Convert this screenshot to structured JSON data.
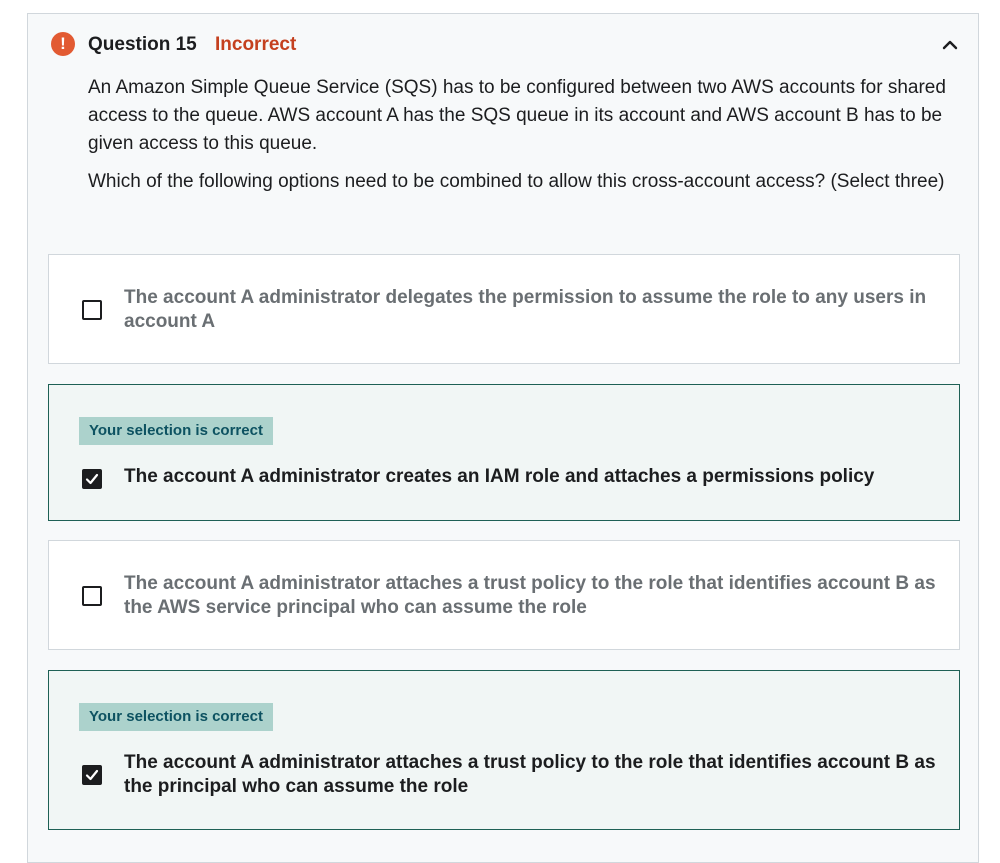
{
  "question": {
    "number_label": "Question 15",
    "status": "Incorrect",
    "prompt_paragraphs": [
      "An Amazon Simple Queue Service (SQS) has to be configured between two AWS accounts for shared access to the queue. AWS account A has the SQS queue in its account and AWS account B has to be given access to this queue.",
      "Which of the following options need to be combined to allow this cross-account access? (Select three)"
    ]
  },
  "options": [
    {
      "text": "The account A administrator delegates the permission to assume the role to any users in account A",
      "selected": false,
      "badge": null
    },
    {
      "text": "The account A administrator creates an IAM role and attaches a permissions policy",
      "selected": true,
      "badge": "Your selection is correct"
    },
    {
      "text": "The account A administrator attaches a trust policy to the role that identifies account B as the AWS service principal who can assume the role",
      "selected": false,
      "badge": null
    },
    {
      "text": "The account A administrator attaches a trust policy to the role that identifies account B as the principal who can assume the role",
      "selected": true,
      "badge": "Your selection is correct"
    }
  ],
  "icons": {
    "status": "alert-icon",
    "collapse": "chevron-up-icon",
    "checked": "checkmark-icon"
  },
  "colors": {
    "incorrect": "#c4401f",
    "alert": "#e25a32",
    "correct_border": "#1e6055",
    "correct_bg": "#f1f6f5",
    "badge_bg": "#acd2cc",
    "badge_text": "#0d5261"
  }
}
